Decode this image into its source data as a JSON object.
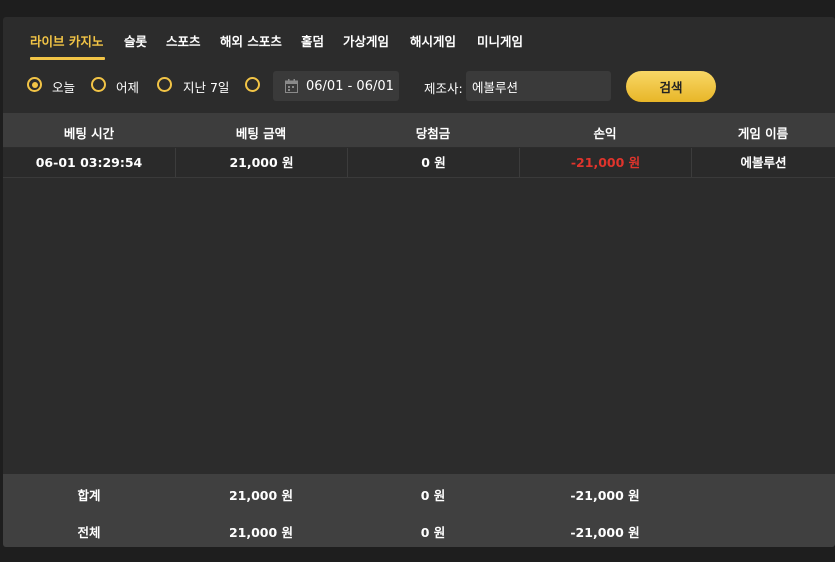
{
  "tabs": [
    {
      "label": "라이브 카지노",
      "active": true
    },
    {
      "label": "슬롯",
      "active": false
    },
    {
      "label": "스포츠",
      "active": false
    },
    {
      "label": "해외 스포츠",
      "active": false
    },
    {
      "label": "홀덤",
      "active": false
    },
    {
      "label": "가상게임",
      "active": false
    },
    {
      "label": "해시게임",
      "active": false
    },
    {
      "label": "미니게임",
      "active": false
    }
  ],
  "filters": {
    "periods": [
      {
        "label": "오늘",
        "checked": true
      },
      {
        "label": "어제",
        "checked": false
      },
      {
        "label": "지난 7일",
        "checked": false
      },
      {
        "label": "",
        "checked": false
      }
    ],
    "date_range": "06/01 - 06/01",
    "maker_label": "제조사:",
    "maker_value": "에볼루션",
    "search_label": "검색"
  },
  "table": {
    "headers": [
      "베팅 시간",
      "베팅 금액",
      "당첨금",
      "손익",
      "게임 이름"
    ],
    "rows": [
      {
        "time": "06-01 03:29:54",
        "bet": "21,000 원",
        "win": "0 원",
        "profit": "-21,000 원",
        "game": "에볼루션"
      }
    ]
  },
  "summary": {
    "subtotal": {
      "label": "합계",
      "bet": "21,000 원",
      "win": "0 원",
      "profit": "-21,000 원"
    },
    "total": {
      "label": "전체",
      "bet": "21,000 원",
      "win": "0 원",
      "profit": "-21,000 원"
    }
  },
  "colors": {
    "accent": "#f2c446",
    "negative": "#e0342c",
    "background": "#2c2c2c"
  }
}
